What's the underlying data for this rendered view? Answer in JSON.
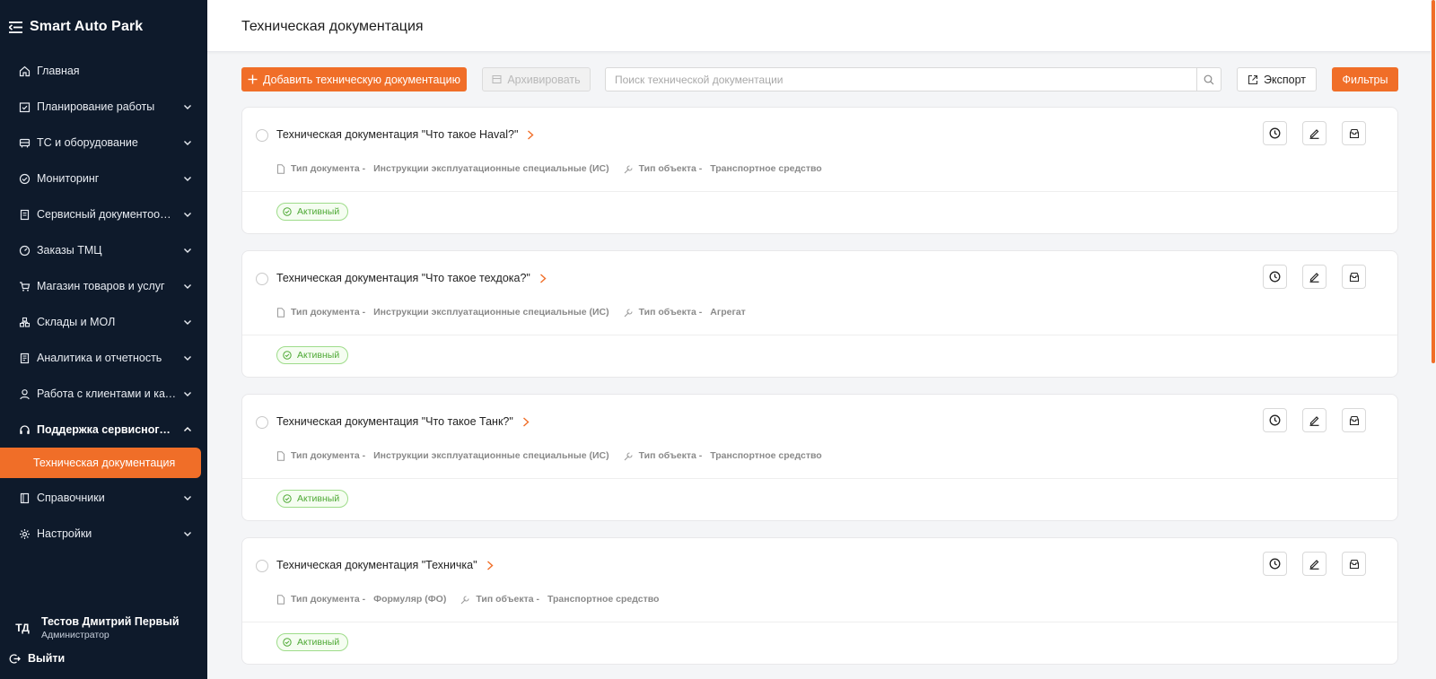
{
  "app": {
    "title": "Smart Auto Park"
  },
  "sidebar": {
    "items": [
      {
        "label": "Главная",
        "icon": "home-icon",
        "has_chevron": false
      },
      {
        "label": "Планирование работы",
        "icon": "calendar-icon",
        "has_chevron": true
      },
      {
        "label": "ТС и оборудование",
        "icon": "car-icon",
        "has_chevron": true
      },
      {
        "label": "Мониторинг",
        "icon": "check-circle-icon",
        "has_chevron": true
      },
      {
        "label": "Сервисный документооборот",
        "icon": "document-icon",
        "has_chevron": true
      },
      {
        "label": "Заказы ТМЦ",
        "icon": "dashboard-icon",
        "has_chevron": true
      },
      {
        "label": "Магазин товаров и услуг",
        "icon": "cart-icon",
        "has_chevron": true
      },
      {
        "label": "Склады и МОЛ",
        "icon": "warehouse-icon",
        "has_chevron": true
      },
      {
        "label": "Аналитика и отчетность",
        "icon": "report-icon",
        "has_chevron": true
      },
      {
        "label": "Работа с клиентами и качеством",
        "icon": "user-icon",
        "has_chevron": true
      },
      {
        "label": "Поддержка сервисного персонала",
        "icon": "headset-icon",
        "has_chevron": true,
        "open": true
      },
      {
        "label": "Справочники",
        "icon": "book-icon",
        "has_chevron": true
      },
      {
        "label": "Настройки",
        "icon": "gear-icon",
        "has_chevron": true
      }
    ],
    "active_subitem": "Техническая документация"
  },
  "user": {
    "initials": "ТД",
    "name": "Тестов Дмитрий Первый",
    "role": "Администратор"
  },
  "logout_label": "Выйти",
  "header": {
    "title": "Техническая документация"
  },
  "toolbar": {
    "add_label": "Добавить техническую документацию",
    "archive_label": "Архивировать",
    "search_placeholder": "Поиск технической документации",
    "export_label": "Экспорт",
    "filters_label": "Фильтры"
  },
  "meta_labels": {
    "doc_type": "Тип документа -",
    "object_type": "Тип объекта -"
  },
  "documents": [
    {
      "title": "Техническая документация \"Что такое Haval?\"",
      "doc_type": "Инструкции эксплуатационные специальные (ИС)",
      "object_type": "Транспортное средство",
      "status": "Активный"
    },
    {
      "title": "Техническая документация \"Что такое техдока?\"",
      "doc_type": "Инструкции эксплуатационные специальные (ИС)",
      "object_type": "Агрегат",
      "status": "Активный"
    },
    {
      "title": "Техническая документация \"Что такое Танк?\"",
      "doc_type": "Инструкции эксплуатационные специальные (ИС)",
      "object_type": "Транспортное средство",
      "status": "Активный"
    },
    {
      "title": "Техническая документация \"Техничка\"",
      "doc_type": "Формуляр (ФО)",
      "object_type": "Транспортное средство",
      "status": "Активный"
    }
  ],
  "colors": {
    "accent": "#f06e28",
    "sidebar_bg": "#0e1a2b",
    "status_green": "#4ea935"
  }
}
